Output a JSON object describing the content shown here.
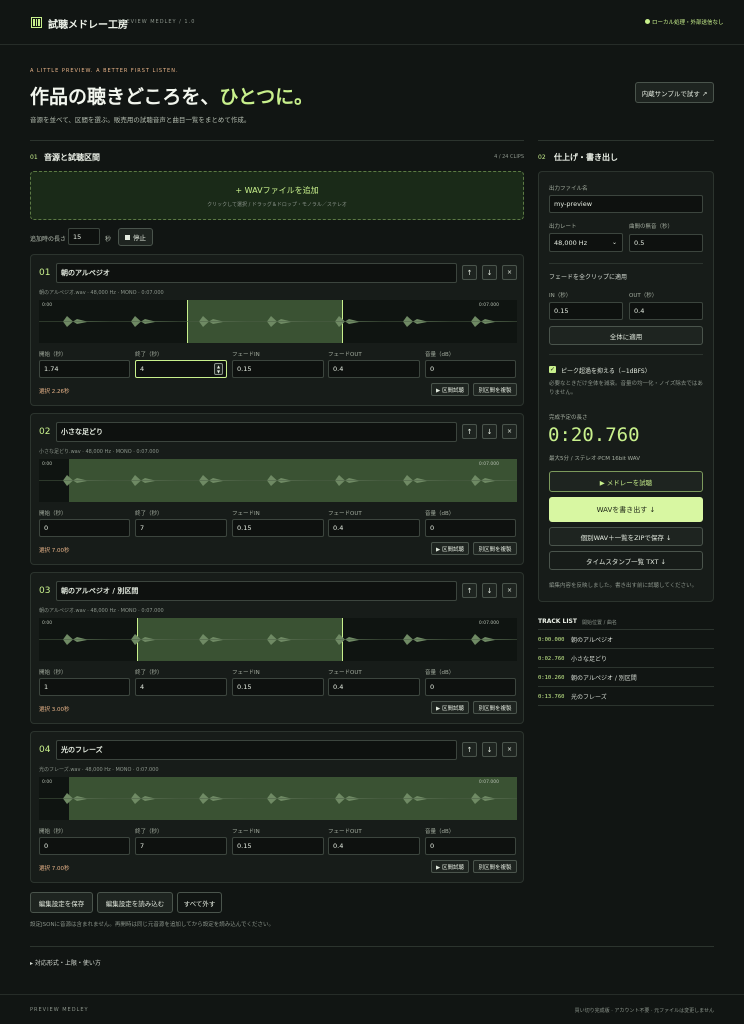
{
  "header": {
    "app_name": "試聴メドレー工房",
    "subtitle": "PREVIEW MEDLEY / 1.0",
    "status": "ローカル処理・外部送信なし"
  },
  "hero": {
    "eyebrow": "A LITTLE PREVIEW. A BETTER FIRST LISTEN.",
    "title_a": "作品の聴きどころを、",
    "title_b": "ひとつに。",
    "description": "音源を並べて、区間を選ぶ。販売用の試聴音声と曲目一覧をまとめて作成。",
    "sample_button": "内蔵サンプルで試す ↗"
  },
  "sources": {
    "num": "01",
    "title": "音源と試聴区間",
    "count": "4 / 24 CLIPS",
    "add_label": "+ WAVファイルを追加",
    "add_hint": "クリックして選択 / ドラッグ＆ドロップ・モノラル／ステレオ",
    "add_length_label": "追加時の長さ",
    "add_length_value": "15",
    "add_length_unit": "秒",
    "stop_label": "停止"
  },
  "field_labels": {
    "start": "開始（秒）",
    "end": "終了（秒）",
    "fade_in": "フェードIN",
    "fade_out": "フェードOUT",
    "volume": "音量（dB）",
    "preview_btn": "▶ 区間試聴",
    "duplicate_btn": "別区間を複製"
  },
  "clips": [
    {
      "num": "01",
      "title": "朝のアルペジオ",
      "meta": "朝のアルペジオ.wav · 48,000 Hz · MONO · 0:07.000",
      "time_start": "0:00",
      "time_end": "0:07.000",
      "start": "1.74",
      "end": "4",
      "fade_in": "0.15",
      "fade_out": "0.4",
      "volume": "0",
      "selection": "選択 2.26秒"
    },
    {
      "num": "02",
      "title": "小さな足どり",
      "meta": "小さな足どり.wav · 48,000 Hz · MONO · 0:07.000",
      "time_start": "0:00",
      "time_end": "0:07.000",
      "start": "0",
      "end": "7",
      "fade_in": "0.15",
      "fade_out": "0.4",
      "volume": "0",
      "selection": "選択 7.00秒"
    },
    {
      "num": "03",
      "title": "朝のアルペジオ / 別区間",
      "meta": "朝のアルペジオ.wav · 48,000 Hz · MONO · 0:07.000",
      "time_start": "0:00",
      "time_end": "0:07.000",
      "start": "1",
      "end": "4",
      "fade_in": "0.15",
      "fade_out": "0.4",
      "volume": "0",
      "selection": "選択 3.00秒"
    },
    {
      "num": "04",
      "title": "光のフレーズ",
      "meta": "光のフレーズ.wav · 48,000 Hz · MONO · 0:07.000",
      "time_start": "0:00",
      "time_end": "0:07.000",
      "start": "0",
      "end": "7",
      "fade_in": "0.15",
      "fade_out": "0.4",
      "volume": "0",
      "selection": "選択 7.00秒"
    }
  ],
  "bottom": {
    "save_settings": "編集設定を保存",
    "load_settings": "編集設定を読み込む",
    "remove_all": "すべて外す",
    "note": "設定JSONに音源は含まれません。再開時は同じ元音源を追加してから設定を読み込んでください。",
    "details": "▸ 対応形式・上限・使い方"
  },
  "finish": {
    "num": "02",
    "title": "仕上げ・書き出し",
    "filename_label": "出力ファイル名",
    "filename_value": "my-preview",
    "rate_label": "出力レート",
    "rate_value": "48,000 Hz",
    "gap_label": "曲間の無音（秒）",
    "gap_value": "0.5",
    "fade_all_label": "フェードを全クリップに適用",
    "in_label": "IN（秒）",
    "in_value": "0.15",
    "out_label": "OUT（秒）",
    "out_value": "0.4",
    "apply_all": "全体に適用",
    "peak_label": "ピーク超過を抑える（−1dBFS）",
    "peak_note": "必要なときだけ全体を減衰。音量の均一化・ノイズ除去ではありません。",
    "length_label": "完成予定の長さ",
    "length_value": "0:20.760",
    "length_note": "最大5分 / ステレオ·PCM 16bit WAV",
    "preview_medley": "▶ メドレーを試聴",
    "export_wav": "WAVを書き出す ↓",
    "export_zip": "個別WAV＋一覧をZIPで保存 ↓",
    "timestamp_txt": "タイムスタンプ一覧 TXT ↓",
    "status_note": "編集内容を反映しました。書き出す前に試聴してください。"
  },
  "track_list": {
    "title": "TRACK LIST",
    "subtitle": "開始位置 / 曲名",
    "items": [
      {
        "time": "0:00.000",
        "name": "朝のアルペジオ"
      },
      {
        "time": "0:02.760",
        "name": "小さな足どり"
      },
      {
        "time": "0:10.260",
        "name": "朝のアルペジオ / 別区間"
      },
      {
        "time": "0:13.760",
        "name": "光のフレーズ"
      }
    ]
  },
  "footer": {
    "left": "PREVIEW MEDLEY",
    "right": "買い切り完成版 · アカウント不要 · 元ファイルは変更しません"
  }
}
